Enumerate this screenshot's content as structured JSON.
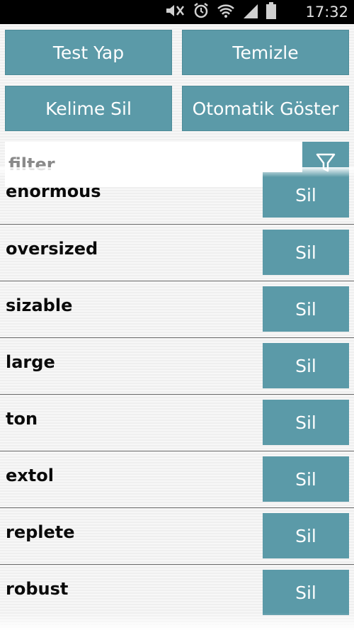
{
  "status_bar": {
    "time": "17:32",
    "icons": [
      "mute-icon",
      "alarm-icon",
      "wifi-icon",
      "signal-icon",
      "battery-icon"
    ]
  },
  "actions": {
    "test_label": "Test Yap",
    "clear_label": "Temizle",
    "delete_word_label": "Kelime Sil",
    "auto_show_label": "Otomatik Göster"
  },
  "filter": {
    "placeholder": "filter",
    "value": ""
  },
  "words": [
    {
      "word": "enormous",
      "delete_label": "Sil"
    },
    {
      "word": "oversized",
      "delete_label": "Sil"
    },
    {
      "word": "sizable",
      "delete_label": "Sil"
    },
    {
      "word": "large",
      "delete_label": "Sil"
    },
    {
      "word": "ton",
      "delete_label": "Sil"
    },
    {
      "word": "extol",
      "delete_label": "Sil"
    },
    {
      "word": "replete",
      "delete_label": "Sil"
    },
    {
      "word": "robust",
      "delete_label": "Sil"
    }
  ],
  "colors": {
    "accent": "#5b9aa8",
    "status_bar": "#000000"
  }
}
